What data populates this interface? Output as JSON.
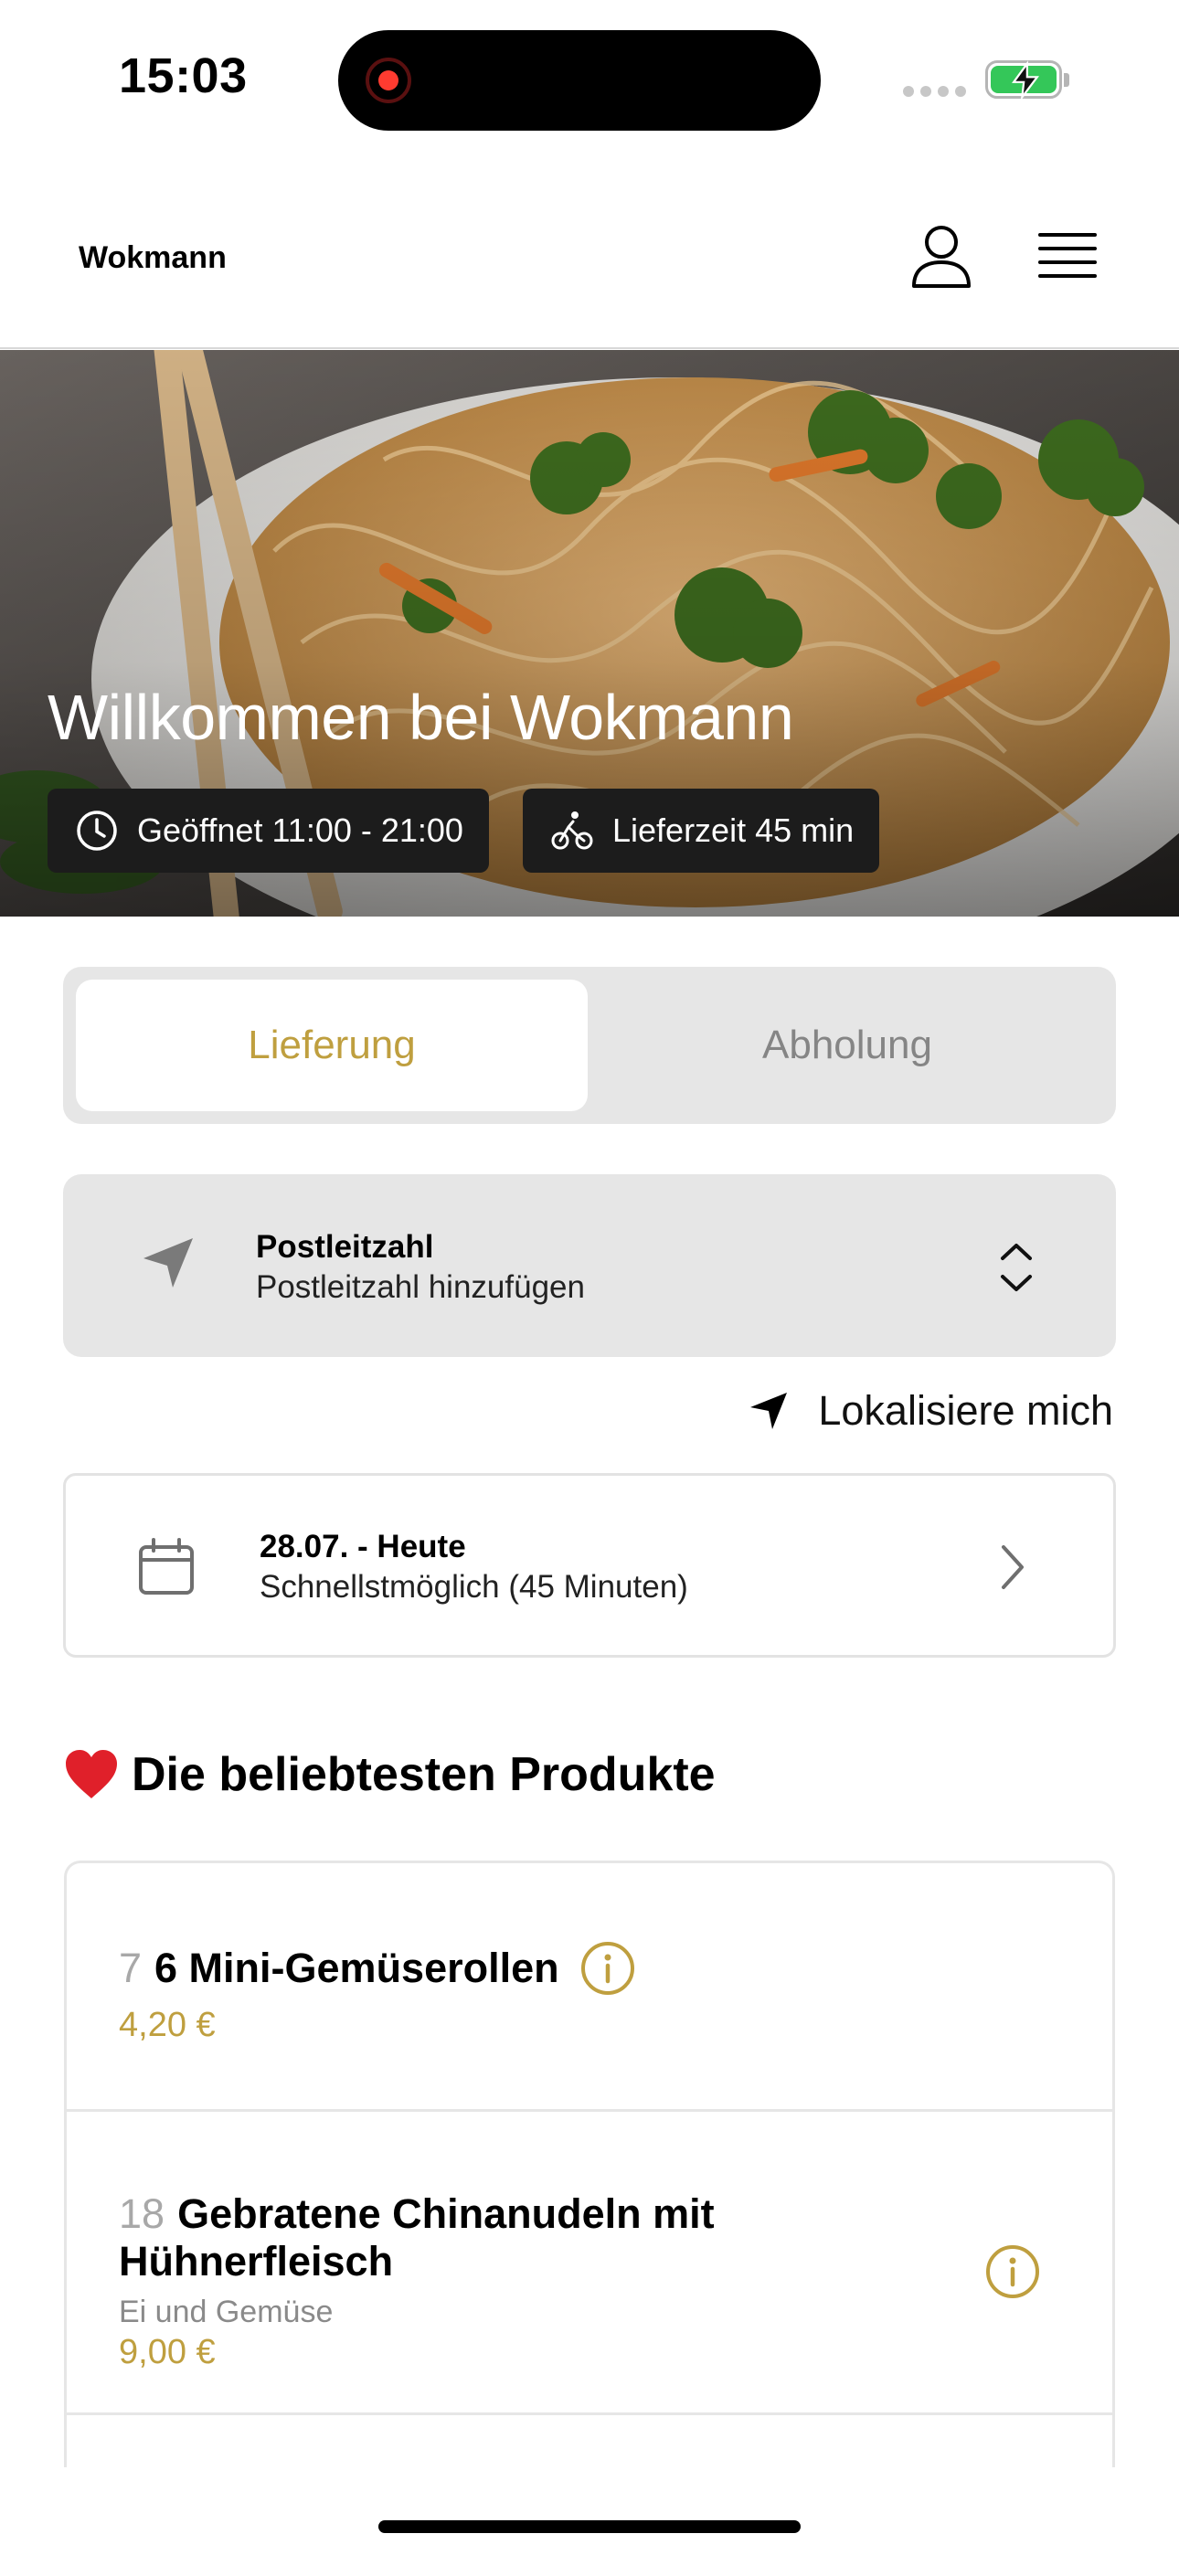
{
  "status_bar": {
    "time": "15:03"
  },
  "header": {
    "brand": "Wokmann",
    "profile_icon": "person-outline-icon",
    "menu_icon": "hamburger-menu-icon"
  },
  "hero": {
    "title": "Willkommen bei Wokmann",
    "opening_hours": "Geöffnet 11:00 - 21:00",
    "delivery_time": "Lieferzeit 45 min"
  },
  "order_mode": {
    "options": [
      "Lieferung",
      "Abholung"
    ],
    "selected": "Lieferung"
  },
  "postcode": {
    "label": "Postleitzahl",
    "placeholder": "Postleitzahl hinzufügen"
  },
  "locate_me": "Lokalisiere mich",
  "schedule": {
    "date": "28.07. - Heute",
    "time": "Schnellstmöglich (45 Minuten)"
  },
  "popular": {
    "emoji": "❤️",
    "title": "Die beliebtesten Produkte",
    "products": [
      {
        "number": "7",
        "name": "6 Mini-Gemüserollen",
        "description": "",
        "price": "4,20 €"
      },
      {
        "number": "18",
        "name": "Gebratene Chinanudeln mit Hühnerfleisch",
        "description": "Ei und Gemüse",
        "price": "9,00 €"
      }
    ]
  },
  "colors": {
    "accent": "#bf9f3f",
    "panel": "#e6e6e6",
    "chip": "#1c1c1c"
  }
}
